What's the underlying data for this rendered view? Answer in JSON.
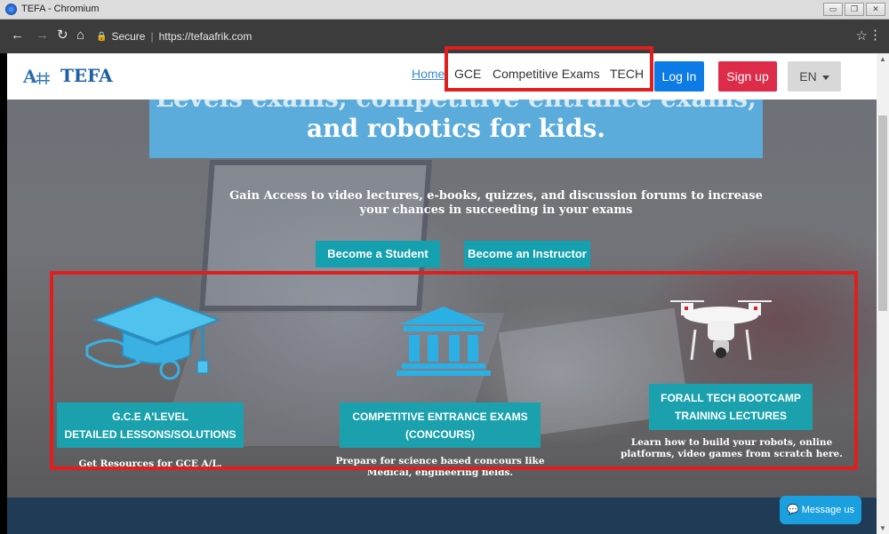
{
  "window": {
    "title": "TEFA - Chromium",
    "controls": [
      "minimize",
      "restore",
      "close"
    ]
  },
  "browser": {
    "secure_label": "Secure",
    "url": "https://tefaafrik.com"
  },
  "nav": {
    "brand": "TEFA",
    "links": [
      "Home",
      "GCE",
      "Competitive Exams",
      "TECH"
    ],
    "login": "Log In",
    "signup": "Sign up",
    "language": "EN"
  },
  "hero": {
    "headline_cut": "Levels exams, competitive entrance exams,",
    "headline": "and robotics for kids.",
    "subtext": "Gain Access to video lectures, e-books, quizzes, and discussion forums to increase your chances in succeeding in your exams",
    "cta_student": "Become a Student",
    "cta_instructor": "Become an Instructor"
  },
  "features": [
    {
      "icon": "graduation-cap-icon",
      "label_line1": "G.C.E A'LEVEL",
      "label_line2": "DETAILED LESSONS/SOLUTIONS",
      "description": "Get Resources for GCE A/L."
    },
    {
      "icon": "institution-icon",
      "label_line1": "COMPETITIVE ENTRANCE EXAMS",
      "label_line2": "(CONCOURS)",
      "description": "Prepare for science based concours like Medical, engineering fields."
    },
    {
      "icon": "drone-icon",
      "label_line1": "FORALL TECH BOOTCAMP",
      "label_line2": "TRAINING LECTURES",
      "description": "Learn how to build your robots, online platforms, video games from scratch here."
    }
  ],
  "chat": {
    "label": "Message us"
  },
  "colors": {
    "brand_blue": "#1e5fa3",
    "teal": "#1ba1ad",
    "login_blue": "#0d7be6",
    "signup_red": "#dd2c4a",
    "highlight_red": "#e01e1e",
    "messenger_blue": "#1aa0df"
  }
}
